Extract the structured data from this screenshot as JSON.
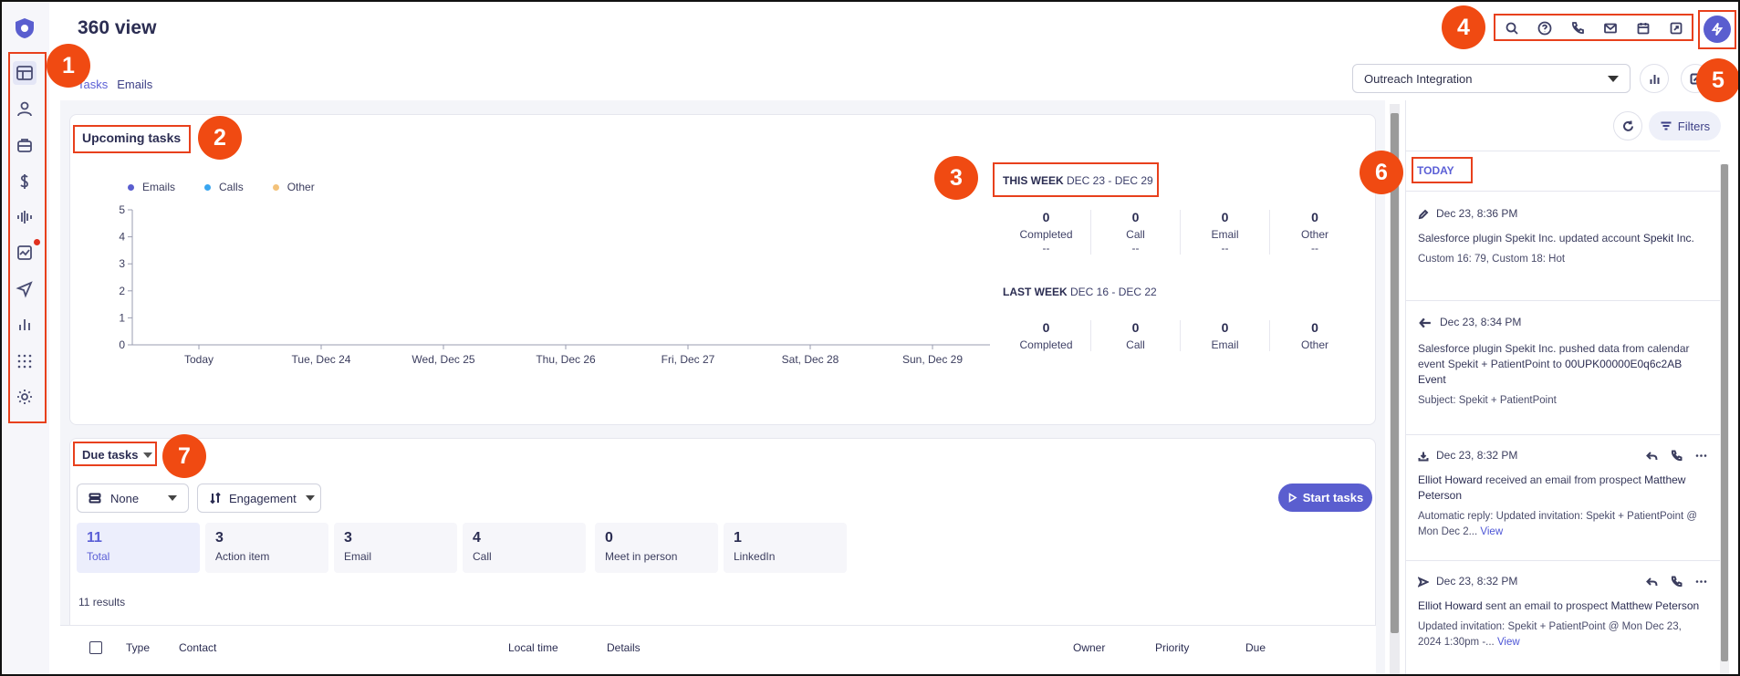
{
  "app": {
    "title": "360 view"
  },
  "tabs": [
    {
      "label": "Tasks"
    },
    {
      "label": "Emails"
    }
  ],
  "toolbar": {
    "integration_select": "Outreach Integration"
  },
  "upcoming": {
    "title": "Upcoming tasks",
    "legend": [
      {
        "label": "Emails",
        "color": "#5a5ecf"
      },
      {
        "label": "Calls",
        "color": "#3aa6f0"
      },
      {
        "label": "Other",
        "color": "#f3c27a"
      }
    ],
    "this_week": {
      "label": "THIS WEEK",
      "range": "DEC 23 - DEC 29",
      "stats": [
        {
          "value": "0",
          "label": "Completed",
          "delta": "--"
        },
        {
          "value": "0",
          "label": "Call",
          "delta": "--"
        },
        {
          "value": "0",
          "label": "Email",
          "delta": "--"
        },
        {
          "value": "0",
          "label": "Other",
          "delta": "--"
        }
      ]
    },
    "last_week": {
      "label": "LAST WEEK",
      "range": "DEC 16 - DEC 22",
      "stats": [
        {
          "value": "0",
          "label": "Completed"
        },
        {
          "value": "0",
          "label": "Call"
        },
        {
          "value": "0",
          "label": "Email"
        },
        {
          "value": "0",
          "label": "Other"
        }
      ]
    }
  },
  "chart_data": {
    "type": "bar",
    "categories": [
      "Today",
      "Tue, Dec 24",
      "Wed, Dec 25",
      "Thu, Dec 26",
      "Fri, Dec 27",
      "Sat, Dec 28",
      "Sun, Dec 29"
    ],
    "series": [
      {
        "name": "Emails",
        "values": [
          0,
          0,
          0,
          0,
          0,
          0,
          0
        ]
      },
      {
        "name": "Calls",
        "values": [
          0,
          0,
          0,
          0,
          0,
          0,
          0
        ]
      },
      {
        "name": "Other",
        "values": [
          0,
          0,
          0,
          0,
          0,
          0,
          0
        ]
      }
    ],
    "yticks": [
      "0",
      "1",
      "2",
      "3",
      "4",
      "5"
    ],
    "ylim": [
      0,
      5
    ],
    "title": "",
    "xlabel": "",
    "ylabel": ""
  },
  "due": {
    "title": "Due tasks",
    "group_select": "None",
    "sort_select": "Engagement",
    "start_button": "Start tasks",
    "tiles": [
      {
        "value": "11",
        "label": "Total"
      },
      {
        "value": "3",
        "label": "Action item"
      },
      {
        "value": "3",
        "label": "Email"
      },
      {
        "value": "4",
        "label": "Call"
      },
      {
        "value": "0",
        "label": "Meet in person"
      },
      {
        "value": "1",
        "label": "LinkedIn"
      }
    ],
    "results": "11 results",
    "columns": [
      "Type",
      "Contact",
      "Local time",
      "Details",
      "Owner",
      "Priority",
      "Due"
    ]
  },
  "activity": {
    "filters_label": "Filters",
    "section": "TODAY",
    "items": [
      {
        "time": "Dec 23, 8:36 PM",
        "text_a": "Salesforce plugin Spekit Inc. updated account ",
        "text_b": "Spekit Inc.",
        "sub": "Custom 16: 79, Custom 18: Hot"
      },
      {
        "time": "Dec 23, 8:34 PM",
        "text_a": "Salesforce plugin Spekit Inc. pushed data from calendar event Spekit + PatientPoint to ",
        "text_b": "00UPK00000E0q6c2AB Event",
        "sub": "Subject: Spekit + PatientPoint"
      },
      {
        "time": "Dec 23, 8:32 PM",
        "text_b0": "Elliot Howard",
        "text_a": " received an email from prospect ",
        "text_b": "Matthew Peterson",
        "sub": "Automatic reply: Updated invitation: Spekit + PatientPoint @ Mon Dec 2...",
        "view": "View"
      },
      {
        "time": "Dec 23, 8:32 PM",
        "text_b0": "Elliot Howard",
        "text_a": " sent an email to prospect ",
        "text_b": "Matthew Peterson",
        "sub": "Updated invitation: Spekit + PatientPoint @ Mon Dec 23, 2024 1:30pm -...",
        "view": "View"
      }
    ]
  },
  "annotations": [
    "1",
    "2",
    "3",
    "4",
    "5",
    "6",
    "7"
  ]
}
